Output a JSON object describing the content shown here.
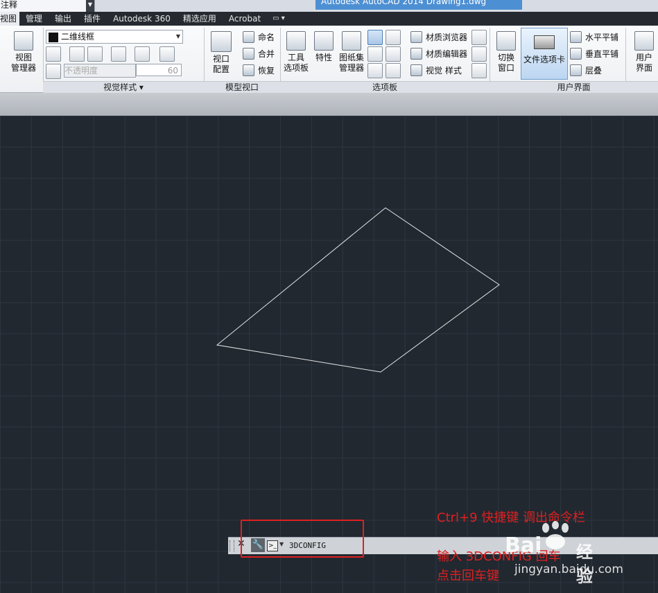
{
  "titlebar": {
    "workspace": "注释",
    "title": "Autodesk AutoCAD 2014      Drawing1.dwg"
  },
  "tabs": [
    "视图",
    "管理",
    "输出",
    "插件",
    "Autodesk 360",
    "精选应用",
    "Acrobat"
  ],
  "ribbon": {
    "view_manager": "视图\n管理器",
    "visual_style_value": "二维线框",
    "transparency_label": "不透明度",
    "transparency_value": "60",
    "viewport_config": "视口\n配置",
    "vp_named": "命名",
    "vp_join": "合并",
    "vp_restore": "恢复",
    "tool_palettes": "工具\n选项板",
    "properties": "特性",
    "sheetset_manager": "图纸集\n管理器",
    "materials_browser": "材质浏览器",
    "materials_editor": "材质编辑器",
    "visual_styles": "视觉 样式",
    "switch_windows": "切换\n窗口",
    "file_tabs": "文件选项卡",
    "tile_horizontal": "水平平铺",
    "tile_vertical": "垂直平铺",
    "cascade": "层叠",
    "user_interface": "用户\n界面",
    "panels": {
      "visual_styles": "视觉样式",
      "model_viewports": "模型视口",
      "palettes": "选项板",
      "user_interface": "用户界面"
    }
  },
  "command_line": {
    "value": "3DCONFIG"
  },
  "annotations": {
    "line1": "Ctrl+9  快捷键  调出命令栏",
    "line2": "输入 3DCONFIG 回车",
    "line3": "点击回车键"
  },
  "watermark": {
    "brand": "Bai",
    "brand_cn": "经验",
    "url": "jingyan.baidu.com"
  },
  "colors": {
    "canvas": "#212830",
    "accent_red": "#e02020",
    "title_blue": "#4d8fd3"
  }
}
